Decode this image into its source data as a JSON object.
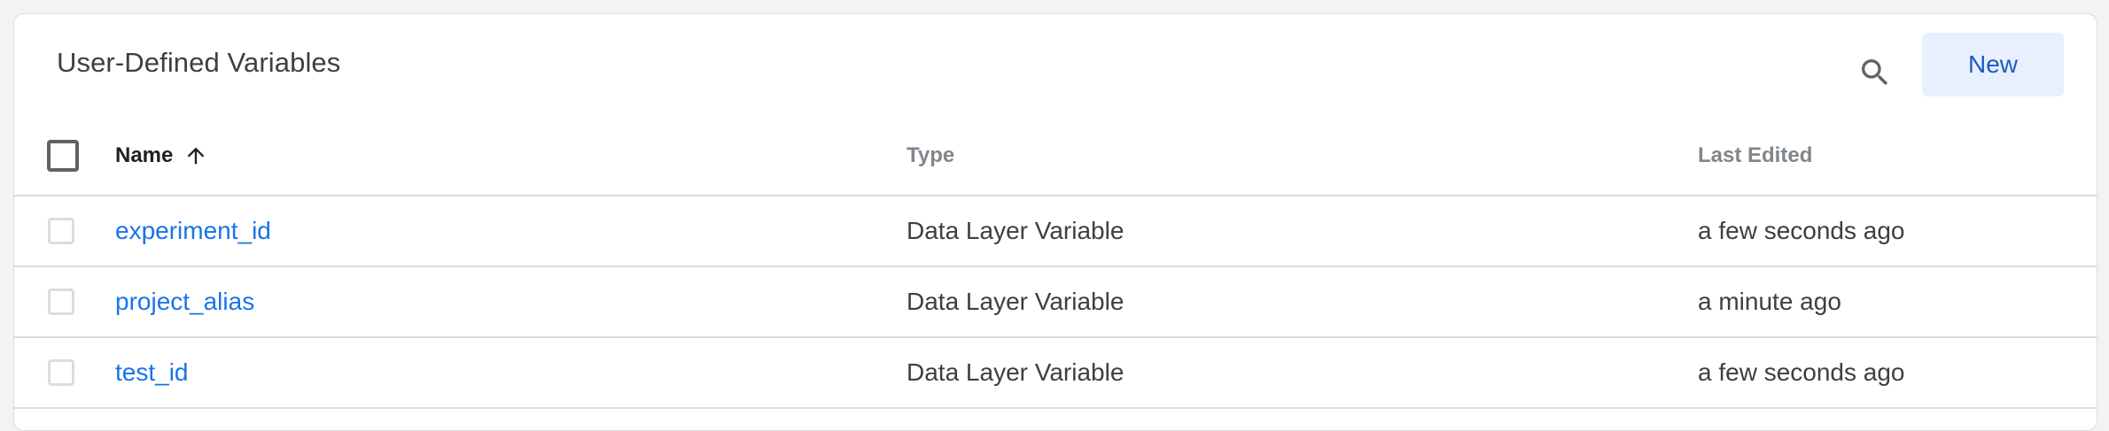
{
  "card": {
    "title": "User-Defined Variables",
    "new_button_label": "New",
    "search_icon": "search-icon"
  },
  "table": {
    "headers": {
      "name": "Name",
      "type": "Type",
      "last_edited": "Last Edited",
      "sort_icon": "arrow-up-icon"
    },
    "rows": [
      {
        "name": "experiment_id",
        "type": "Data Layer Variable",
        "last_edited": "a few seconds ago"
      },
      {
        "name": "project_alias",
        "type": "Data Layer Variable",
        "last_edited": "a minute ago"
      },
      {
        "name": "test_id",
        "type": "Data Layer Variable",
        "last_edited": "a few seconds ago"
      }
    ]
  },
  "colors": {
    "link": "#1a73e8",
    "button_bg": "#e8f0fe",
    "button_text": "#1a5bc4"
  }
}
